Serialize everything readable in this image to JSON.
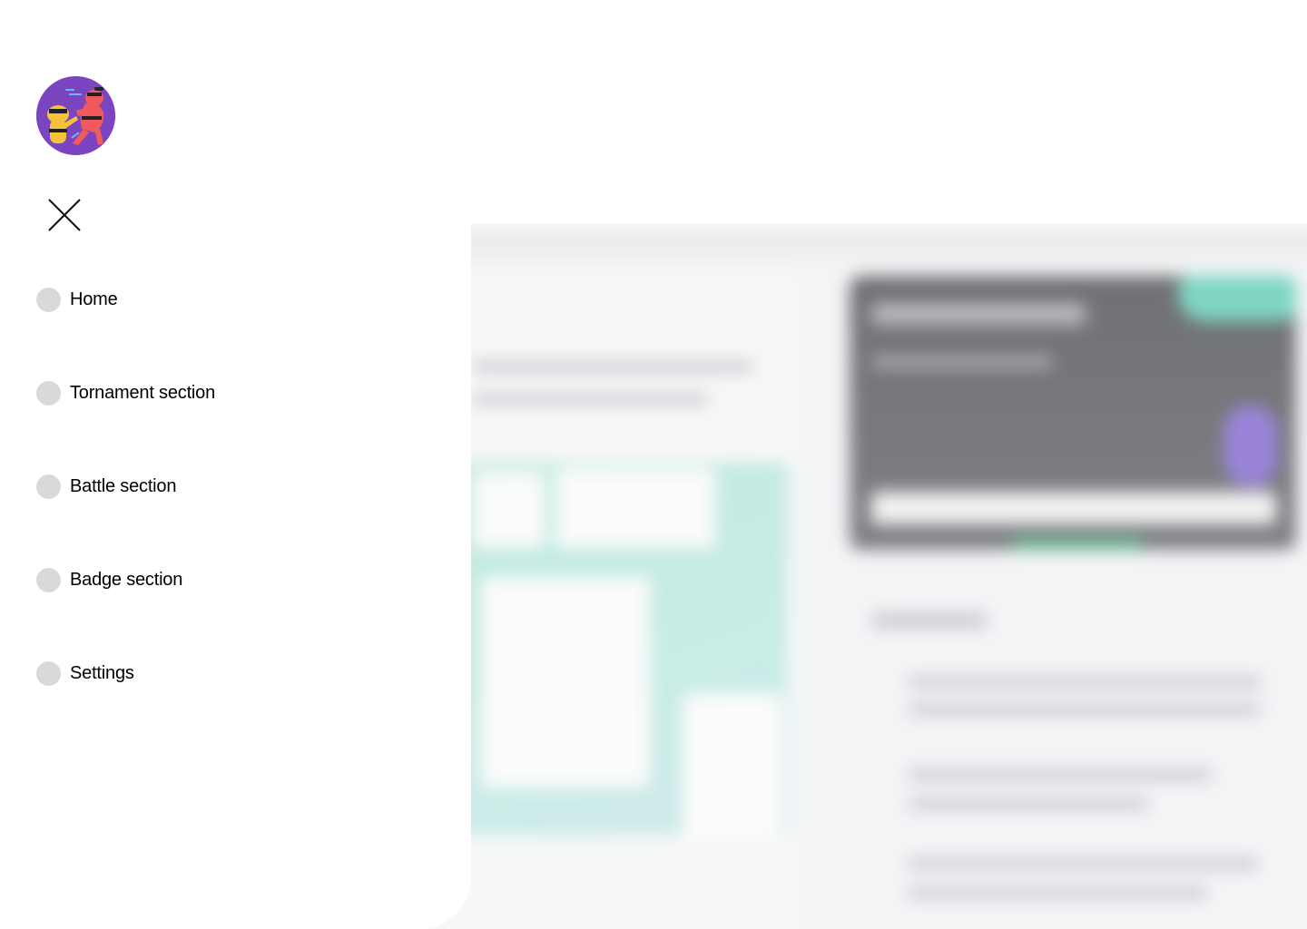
{
  "app": {
    "avatar_icon": "ninja-fighters-avatar",
    "close_icon": "close-icon"
  },
  "menu": {
    "items": [
      {
        "label": "Home",
        "icon": "circle-bullet-icon"
      },
      {
        "label": "Tornament section",
        "icon": "circle-bullet-icon"
      },
      {
        "label": "Battle section",
        "icon": "circle-bullet-icon"
      },
      {
        "label": "Badge section",
        "icon": "circle-bullet-icon"
      },
      {
        "label": "Settings",
        "icon": "circle-bullet-icon"
      }
    ]
  },
  "colors": {
    "avatar_bg": "#7b45c2",
    "dot": "#d9d9d9",
    "panel_bg": "#ffffff",
    "backdrop": "#f3f4f6"
  }
}
